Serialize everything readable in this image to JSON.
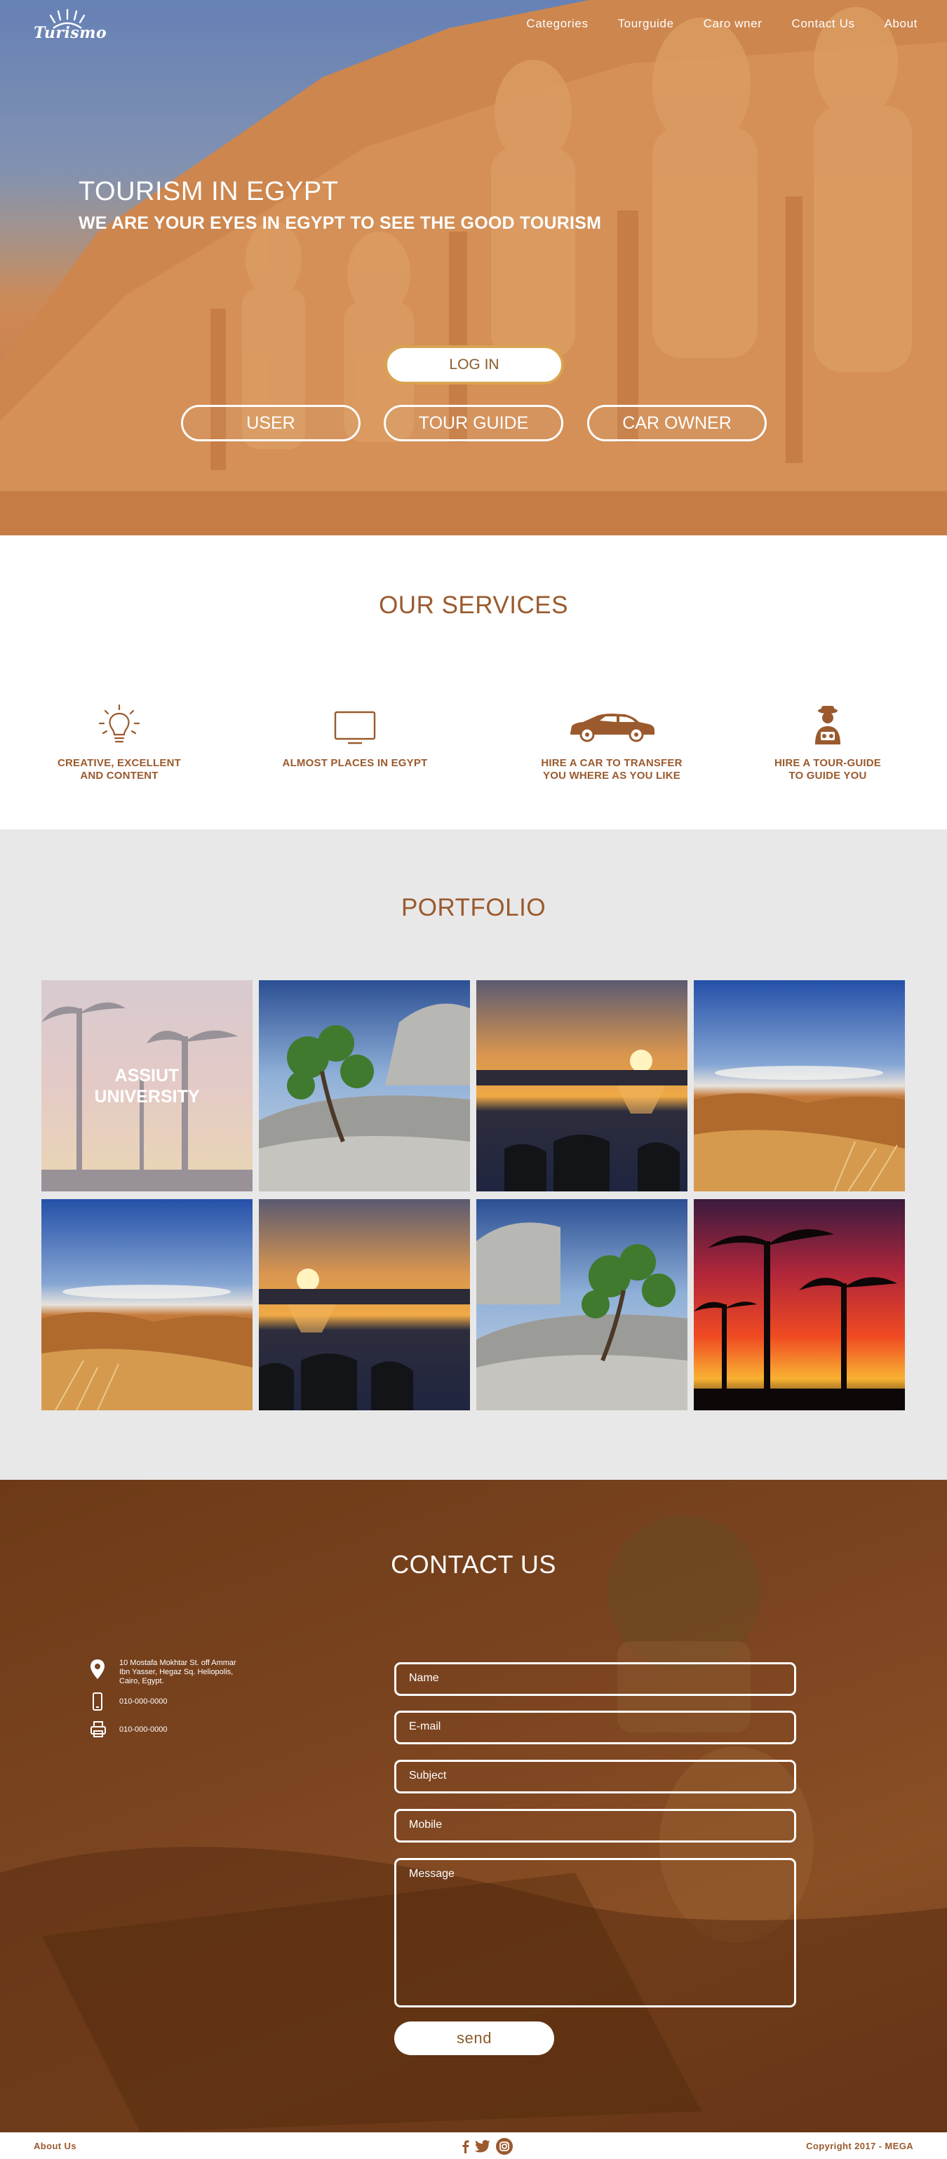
{
  "brand": {
    "logo_text": "Turismo"
  },
  "nav": {
    "items": [
      "Categories",
      "Tourguide",
      "Caro wner",
      "Contact Us",
      "About"
    ]
  },
  "hero": {
    "title": "TOURISM IN EGYPT",
    "subtitle": "WE ARE YOUR EYES IN EGYPT TO SEE THE GOOD TOURISM",
    "login_label": "LOG IN",
    "roles": [
      "USER",
      "TOUR GUIDE",
      "CAR OWNER"
    ]
  },
  "services": {
    "title": "OUR SERVICES",
    "items": [
      {
        "icon": "lightbulb-icon",
        "line1": "CREATIVE, EXCELLENT",
        "line2": "AND CONTENT"
      },
      {
        "icon": "monitor-icon",
        "line1": "ALMOST PLACES IN EGYPT",
        "line2": ""
      },
      {
        "icon": "car-icon",
        "line1": "HIRE A CAR TO TRANSFER",
        "line2": "YOU WHERE AS YOU LIKE"
      },
      {
        "icon": "tour-guide-icon",
        "line1": "HIRE A TOUR-GUIDE",
        "line2": "TO GUIDE YOU"
      }
    ]
  },
  "portfolio": {
    "title": "PORTFOLIO",
    "highlight_caption_line1": "ASSIUT",
    "highlight_caption_line2": "UNIVERSITY"
  },
  "contact": {
    "title": "CONTACT US",
    "address_line1": "10 Mostafa Mokhtar St. off Ammar",
    "address_line2": "Ibn Yasser, Hegaz Sq. Heliopolis,",
    "address_line3": "Cairo, Egypt.",
    "phone": "010-000-0000",
    "fax": "010-000-0000",
    "form": {
      "name_placeholder": "Name",
      "email_placeholder": "E-mail",
      "subject_placeholder": "Subject",
      "mobile_placeholder": "Mobile",
      "message_placeholder": "Message",
      "send_label": "send"
    }
  },
  "footer": {
    "about_label": "About Us",
    "copyright": "Copyright 2017 - MEGA"
  },
  "colors": {
    "brand_brown": "#9a5a2e",
    "accent_gold": "#d9a24f",
    "portfolio_bg": "#e8e8e8"
  }
}
